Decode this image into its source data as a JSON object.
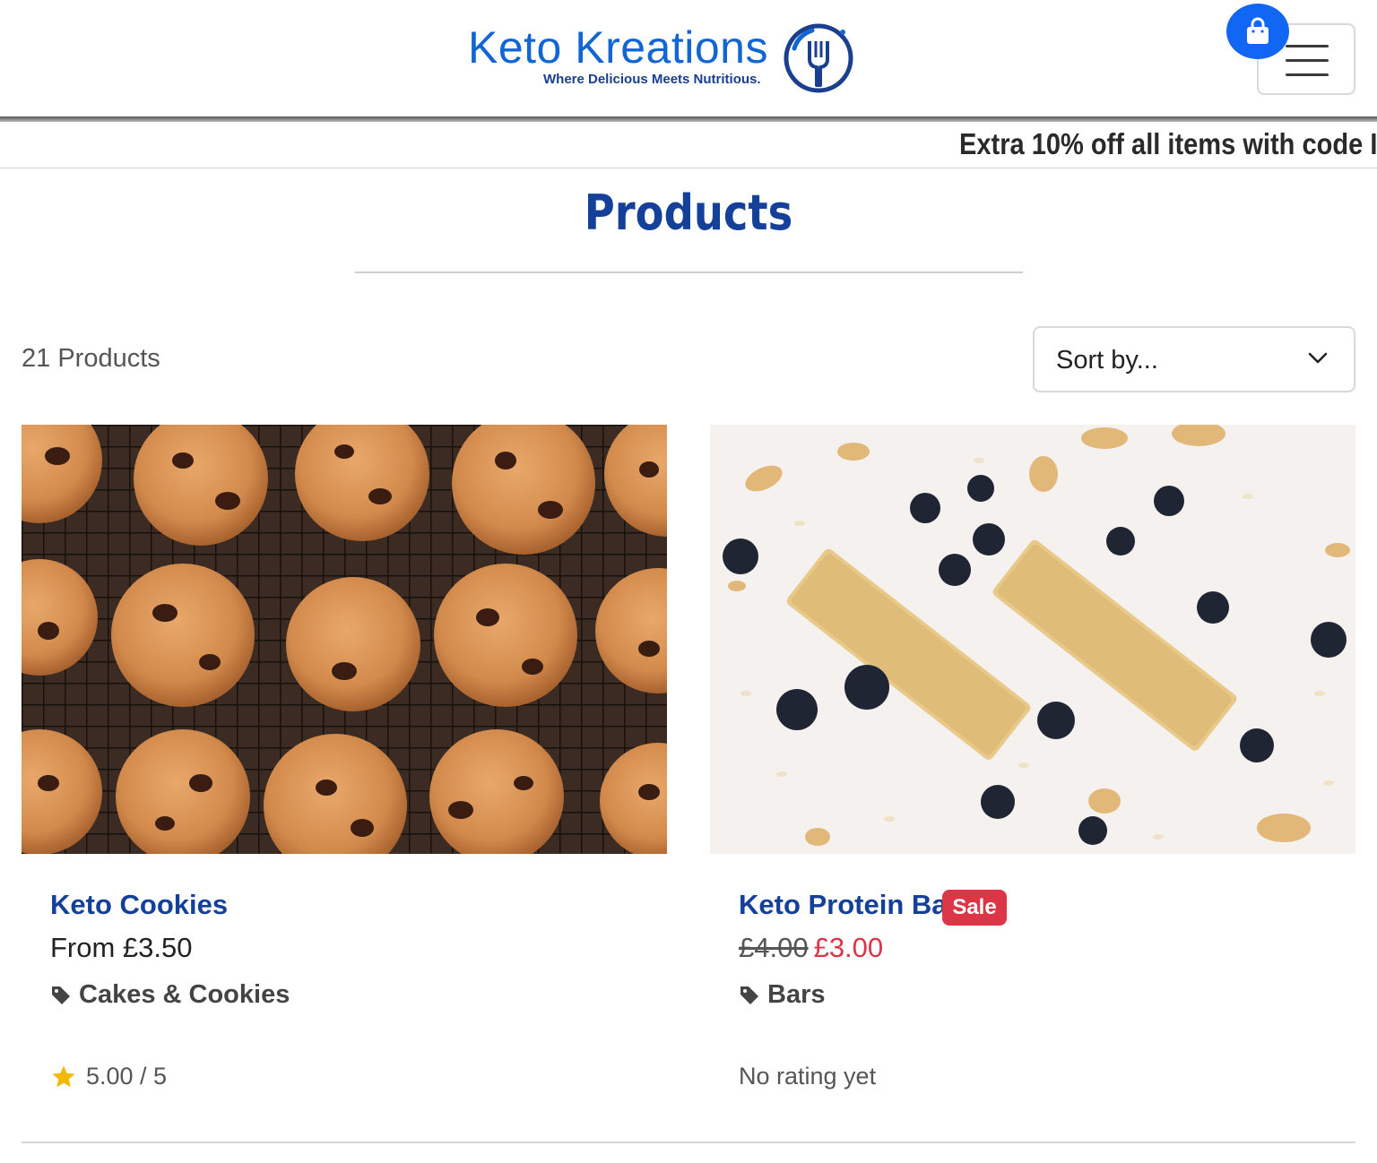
{
  "header": {
    "logo_name": "Keto Kreations",
    "logo_tagline": "Where Delicious Meets Nutritious.",
    "brand_color": "#1266d4",
    "cart_icon": "shopping-bag-icon",
    "menu_icon": "hamburger-menu-icon"
  },
  "announcement": {
    "text": "Extra 10% off all items with code I"
  },
  "page": {
    "title": "Products",
    "count_label": "21 Products"
  },
  "sort": {
    "label": "Sort by...",
    "icon": "chevron-down-icon"
  },
  "products": [
    {
      "name": "Keto Cookies",
      "price": "From £3.50",
      "category": "Cakes & Cookies",
      "rating_text": "5.00 / 5",
      "image": "chocolate-chip-cookies-on-cooling-rack"
    },
    {
      "name": "Keto Protein Bars",
      "badge": "Sale",
      "price_old": "£4.00",
      "price_new": "£3.00",
      "category": "Bars",
      "rating_text": "No rating yet",
      "image": "oat-bars-with-blueberries"
    }
  ],
  "colors": {
    "title": "#14409a",
    "sale": "#dc3545",
    "star": "#f5b800"
  }
}
